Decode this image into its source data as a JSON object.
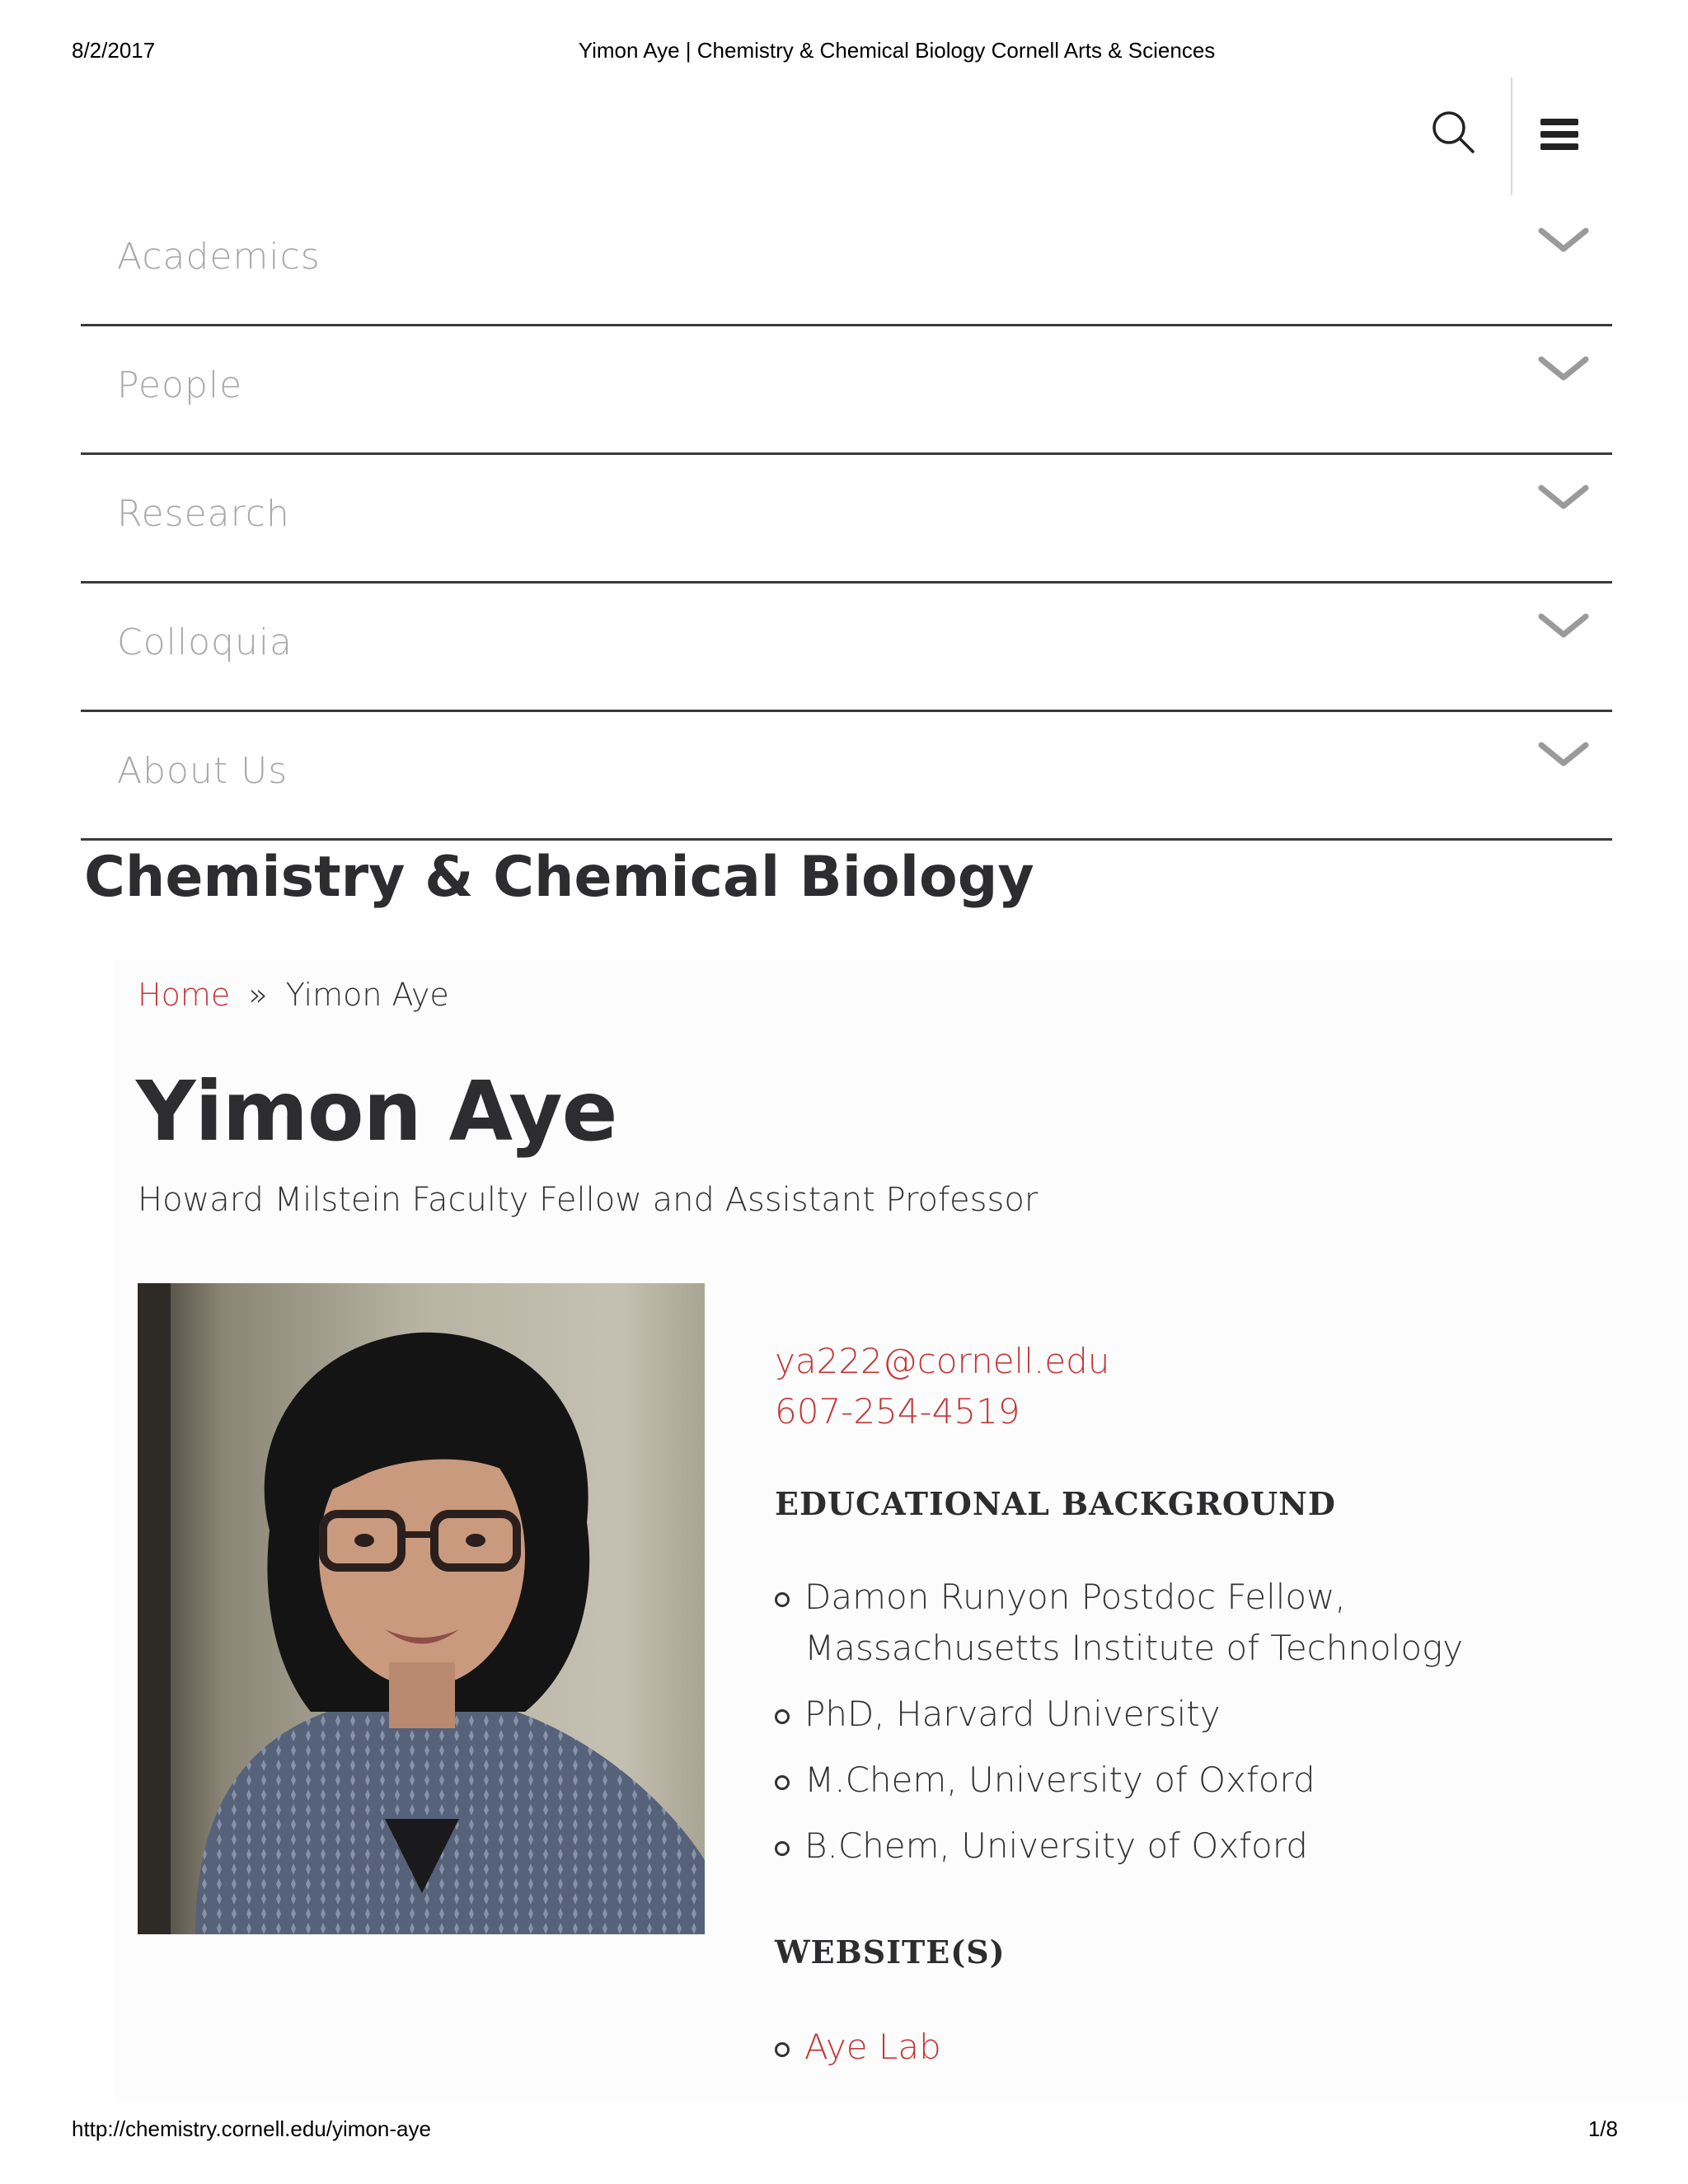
{
  "print": {
    "date": "8/2/2017",
    "title": "Yimon Aye | Chemistry & Chemical Biology Cornell Arts & Sciences",
    "url": "http://chemistry.cornell.edu/yimon-aye",
    "page": "1/8"
  },
  "nav": {
    "items": [
      {
        "label": "Academics"
      },
      {
        "label": "People"
      },
      {
        "label": "Research"
      },
      {
        "label": "Colloquia"
      },
      {
        "label": "About Us"
      }
    ]
  },
  "department": "Chemistry & Chemical Biology",
  "breadcrumb": {
    "home": "Home",
    "separator": "»",
    "current": "Yimon Aye"
  },
  "profile": {
    "name": "Yimon Aye",
    "title": "Howard Milstein Faculty Fellow and Assistant Professor",
    "email": "ya222@cornell.edu",
    "phone": "607-254-4519",
    "education_heading": "EDUCATIONAL BACKGROUND",
    "education": [
      "Damon Runyon Postdoc Fellow, Massachusetts Institute of Technology",
      "PhD, Harvard University",
      "M.Chem, University of Oxford",
      "B.Chem, University of Oxford"
    ],
    "websites_heading": "WEBSITE(S)",
    "websites": [
      "Aye Lab"
    ]
  },
  "colors": {
    "link": "#c53638",
    "text": "#2d2c2e",
    "nav_text": "#a8a8a8"
  }
}
